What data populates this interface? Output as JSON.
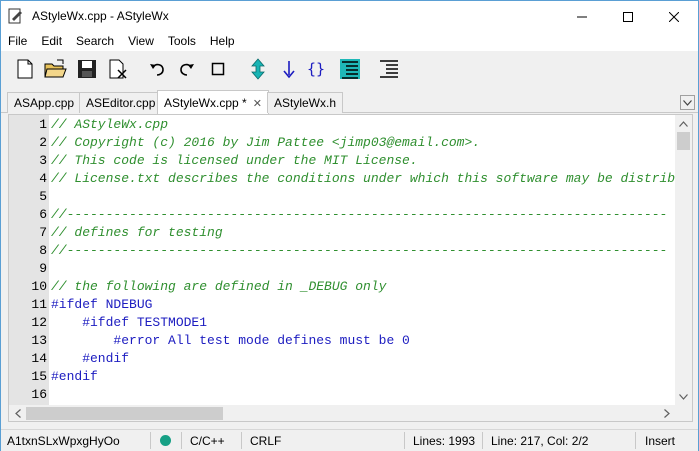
{
  "window": {
    "title": "AStyleWx.cpp - AStyleWx",
    "minimize_icon": "minimize-icon",
    "maximize_icon": "maximize-icon",
    "close_icon": "close-icon"
  },
  "menu": {
    "items": [
      {
        "label": "File"
      },
      {
        "label": "Edit"
      },
      {
        "label": "Search"
      },
      {
        "label": "View"
      },
      {
        "label": "Tools"
      },
      {
        "label": "Help"
      }
    ]
  },
  "toolbar": {
    "icons": [
      "new-file-icon",
      "open-folder-icon",
      "save-icon",
      "close-file-icon",
      "undo-icon",
      "redo-icon",
      "stop-icon",
      "expand-vertical-icon",
      "arrow-down-icon",
      "braces-icon",
      "format-icon",
      "indent-icon"
    ]
  },
  "tabs": {
    "items": [
      {
        "label": "ASApp.cpp",
        "active": false
      },
      {
        "label": "ASEditor.cpp",
        "active": false
      },
      {
        "label": "AStyleWx.cpp *",
        "active": true
      },
      {
        "label": "AStyleWx.h",
        "active": false
      }
    ],
    "close_glyph": "✕"
  },
  "editor": {
    "lines": [
      {
        "n": "1",
        "text": "// AStyleWx.cpp",
        "kind": "comment"
      },
      {
        "n": "2",
        "text": "// Copyright (c) 2016 by Jim Pattee <jimp03@email.com>.",
        "kind": "comment"
      },
      {
        "n": "3",
        "text": "// This code is licensed under the MIT License.",
        "kind": "comment"
      },
      {
        "n": "4",
        "text": "// License.txt describes the conditions under which this software may be distributed.",
        "kind": "comment"
      },
      {
        "n": "5",
        "text": "",
        "kind": "plain"
      },
      {
        "n": "6",
        "text": "//-----------------------------------------------------------------------------",
        "kind": "comment"
      },
      {
        "n": "7",
        "text": "// defines for testing",
        "kind": "comment"
      },
      {
        "n": "8",
        "text": "//-----------------------------------------------------------------------------",
        "kind": "comment"
      },
      {
        "n": "9",
        "text": "",
        "kind": "plain"
      },
      {
        "n": "10",
        "text": "// the following are defined in _DEBUG only",
        "kind": "comment"
      },
      {
        "n": "11",
        "text": "#ifdef NDEBUG",
        "kind": "pre"
      },
      {
        "n": "12",
        "text": "    #ifdef TESTMODE1",
        "kind": "pre"
      },
      {
        "n": "13",
        "text": "        #error All test mode defines must be 0",
        "kind": "pre"
      },
      {
        "n": "14",
        "text": "    #endif",
        "kind": "pre"
      },
      {
        "n": "15",
        "text": "#endif",
        "kind": "pre"
      },
      {
        "n": "16",
        "text": "",
        "kind": "plain"
      }
    ]
  },
  "status": {
    "options": "A1txnSLxWpxgHyOo",
    "language": "C/C++",
    "eol": "CRLF",
    "lines": "Lines: 1993",
    "position": "Line: 217, Col: 2/2",
    "mode": "Insert",
    "indicator_color": "#16a085"
  },
  "colors": {
    "comment": "#2f8f2f",
    "preprocessor": "#1c1cc0",
    "gutter": "#e4e4e4"
  }
}
